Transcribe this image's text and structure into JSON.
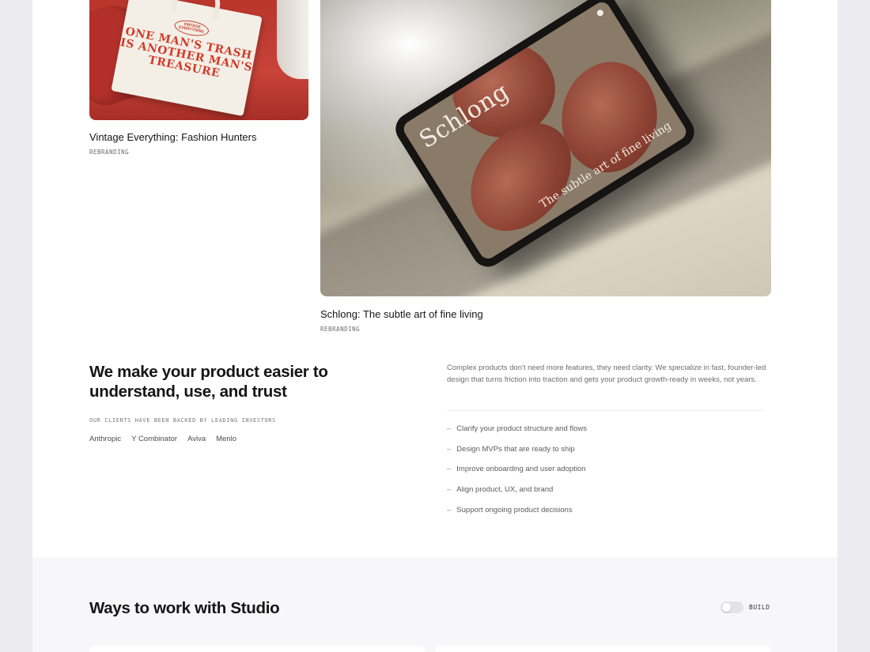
{
  "projects": [
    {
      "title": "Vintage Everything: Fashion Hunters",
      "tag": "REBRANDING",
      "image": {
        "bag_badge": "VINTAGE EVERYTHING",
        "bag_slogan": "ONE MAN'S TRASH IS ANOTHER MAN'S TREASURE"
      }
    },
    {
      "title": "Schlong: The subtle art of fine living",
      "tag": "REBRANDING",
      "image": {
        "screen_brand": "Schlong",
        "screen_tagline": "The subtle art of fine living"
      }
    }
  ],
  "intro_section": {
    "headline": "We make your product easier to understand, use, and trust",
    "investors_label": "OUR CLIENTS HAVE BEEN BACKED BY LEADING INVESTORS",
    "investors": [
      "Anthropic",
      "Y Combinator",
      "Aviva",
      "Menlo"
    ],
    "description": "Complex products don't need more features, they need clarity. We specialize in fast, founder-led design that turns friction into traction and gets your product growth-ready in weeks, not years.",
    "bullets": [
      "Clarify your product structure and flows",
      "Design MVPs that are ready to ship",
      "Improve onboarding and user adoption",
      "Align product, UX, and brand",
      "Support ongoing product decisions"
    ],
    "bullet_marker": "–"
  },
  "ways_section": {
    "title": "Ways to work with Studio",
    "toggle_label": "BUILD",
    "toggle_on": false
  }
}
